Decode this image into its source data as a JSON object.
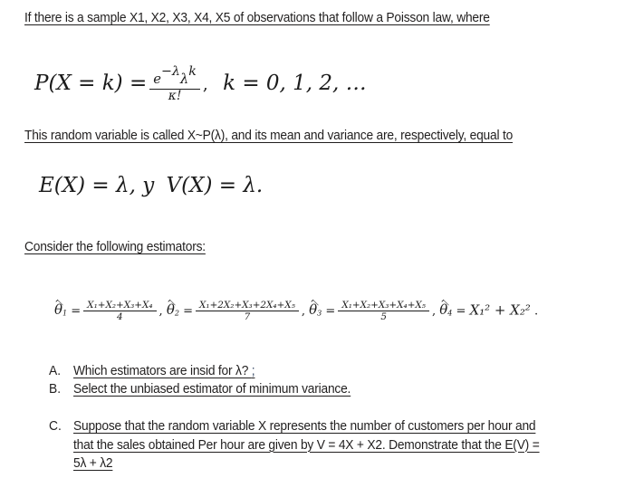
{
  "document": {
    "intro_line": "If there is a sample X1, X2, X3, X4, X5 of observations that follow a Poisson law, where",
    "poisson_formula": {
      "lhs": "P(X = k) =",
      "numerator_e": "e",
      "numerator_e_exp": "−λ",
      "numerator_lambda": "λ",
      "numerator_lambda_exp": "k",
      "denominator": "κ!",
      "comma": ",",
      "support": "k = 0, 1, 2, …"
    },
    "mean_variance_line": "This random variable is called X~P(λ), and its mean and variance are, respectively, equal to",
    "moments_formula": {
      "expectation": "E(X) =",
      "expectation_value": "λ",
      "conjunction": ", y",
      "variance": "V(X) =",
      "variance_value": "λ."
    },
    "estimators_intro": "Consider the following estimators:",
    "estimators": {
      "theta1": {
        "symbol": "θ",
        "index": "1",
        "equals": "=",
        "numerator": "X₁+X₂+X₃+X₄",
        "denominator": "4",
        "separator": ","
      },
      "theta2": {
        "symbol": "θ",
        "index": "2",
        "equals": "=",
        "numerator": "X₁+2X₂+X₃+2X₄+X₅",
        "denominator": "7",
        "separator": ","
      },
      "theta3": {
        "symbol": "θ",
        "index": "3",
        "equals": "=",
        "numerator": "X₁+X₂+X₃+X₄+X₅",
        "denominator": "5",
        "separator": ","
      },
      "theta4": {
        "symbol": "θ",
        "index": "4",
        "equals": "=",
        "expression": "X₁² + X₂²",
        "terminator": "."
      }
    },
    "questions": [
      {
        "letter": "A.",
        "lines": [
          "Which estimators are insid for λ? ;"
        ]
      },
      {
        "letter": "B.",
        "lines": [
          "Select the unbiased estimator of minimum variance."
        ]
      },
      {
        "letter": "C.",
        "lines": [
          "Suppose that the random variable X represents the number of customers per hour and",
          "that the sales obtained Per hour are given by V = 4X + X2. Demonstrate that the E(V) =",
          "5λ + λ2"
        ]
      }
    ]
  },
  "colors": {
    "background": "#ffffff",
    "text": "#211f1f",
    "math_text": "#1b1b1b",
    "accent_semicolon": "#3d4f6b"
  }
}
